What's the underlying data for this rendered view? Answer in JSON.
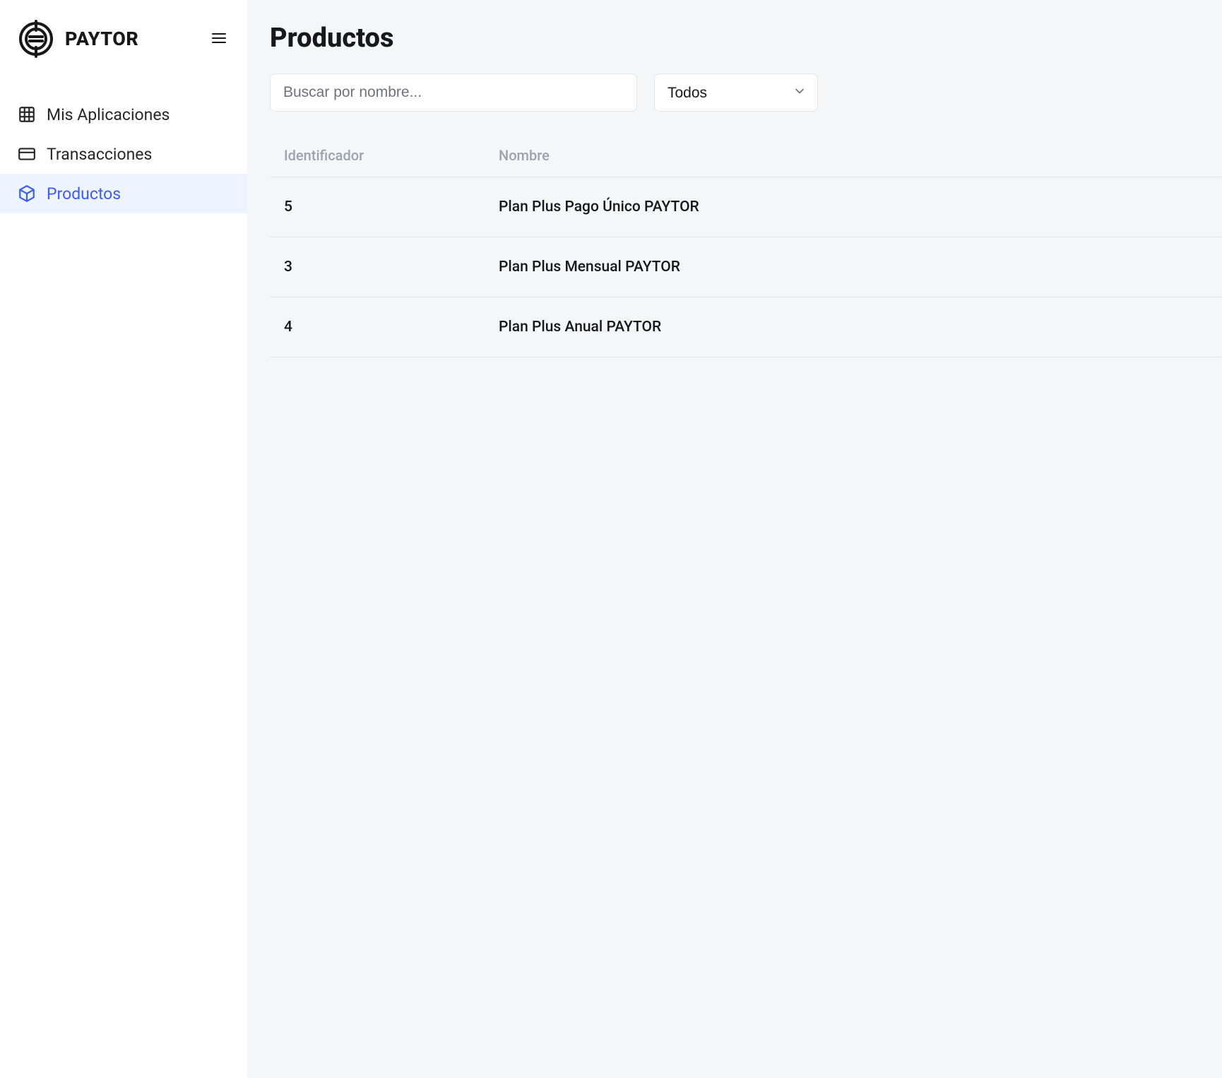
{
  "brand": {
    "name": "PAYTOR"
  },
  "sidebar": {
    "items": [
      {
        "label": "Mis Aplicaciones",
        "icon": "grid",
        "active": false
      },
      {
        "label": "Transacciones",
        "icon": "card",
        "active": false
      },
      {
        "label": "Productos",
        "icon": "box",
        "active": true
      }
    ]
  },
  "main": {
    "title": "Productos",
    "search": {
      "placeholder": "Buscar por nombre..."
    },
    "filter": {
      "selected": "Todos"
    },
    "table": {
      "headers": {
        "id": "Identificador",
        "name": "Nombre"
      },
      "rows": [
        {
          "id": "5",
          "name": "Plan Plus Pago Único PAYTOR"
        },
        {
          "id": "3",
          "name": "Plan Plus Mensual PAYTOR"
        },
        {
          "id": "4",
          "name": "Plan Plus Anual PAYTOR"
        }
      ]
    }
  }
}
